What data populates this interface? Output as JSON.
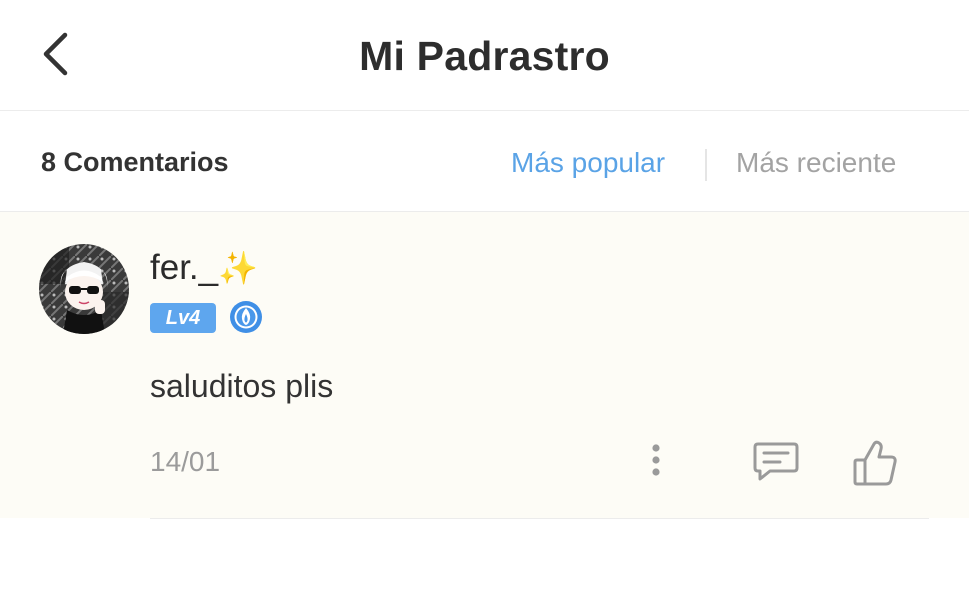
{
  "header": {
    "back_icon": "chevron-left-icon",
    "title": "Mi Padrastro"
  },
  "sort": {
    "count_label": "8 Comentarios",
    "popular_label": "Más popular",
    "recent_label": "Más reciente",
    "active": "Más popular",
    "active_color": "#5aa3e6",
    "inactive_color": "#a3a3a3"
  },
  "comment": {
    "username": "fer._",
    "username_emoji": "✨",
    "level": "Lv4",
    "level_color": "#5ea6ee",
    "badge_icon": "blue-flame-badge-icon",
    "text": "saluditos plis",
    "date": "14/01",
    "actions": [
      "more-options-icon",
      "reply-icon",
      "like-icon"
    ]
  }
}
